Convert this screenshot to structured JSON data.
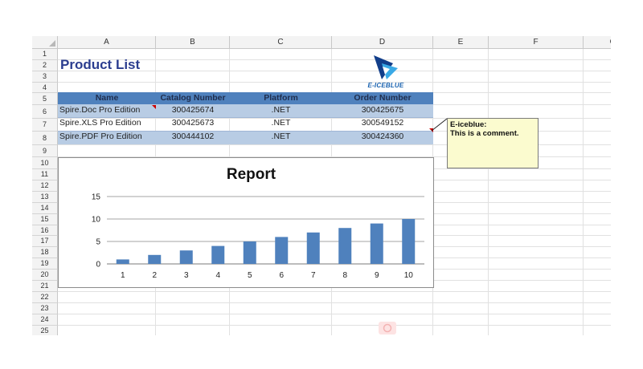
{
  "columns": [
    "A",
    "B",
    "C",
    "D",
    "E",
    "F",
    "G"
  ],
  "rows": [
    "1",
    "2",
    "3",
    "4",
    "5",
    "6",
    "7",
    "8",
    "9",
    "10",
    "11",
    "12",
    "13",
    "14",
    "15",
    "16",
    "17",
    "18",
    "19",
    "20",
    "21",
    "22",
    "23",
    "24",
    "25"
  ],
  "title": "Product List",
  "logo": {
    "text": "E-ICEBLUE",
    "colors": {
      "dark": "#123e8a",
      "light": "#3aa9e6"
    }
  },
  "table": {
    "headers": [
      "Name",
      "Catalog Number",
      "Platform",
      "Order Number"
    ],
    "rows": [
      [
        "Spire.Doc Pro Edition",
        "300425674",
        ".NET",
        "300425675"
      ],
      [
        "Spire.XLS Pro Edition",
        "300425673",
        ".NET",
        "300549152"
      ],
      [
        "Spire.PDF Pro Edition",
        "300444102",
        ".NET",
        "300424360"
      ]
    ],
    "colors": {
      "header_bg": "#4f81bd",
      "band_bg": "#b8cce4"
    }
  },
  "comment": {
    "author": "E-iceblue:",
    "text": "This is a comment."
  },
  "chart_data": {
    "type": "bar",
    "title": "Report",
    "categories": [
      "1",
      "2",
      "3",
      "4",
      "5",
      "6",
      "7",
      "8",
      "9",
      "10"
    ],
    "series": [
      {
        "values": [
          1,
          2,
          3,
          4,
          5,
          6,
          7,
          8,
          9,
          10
        ]
      }
    ],
    "ylim": [
      0,
      15
    ],
    "yticks": [
      "0",
      "5",
      "10",
      "15"
    ],
    "grid": true,
    "legend": "none",
    "bar_color": "#4f81bd"
  }
}
